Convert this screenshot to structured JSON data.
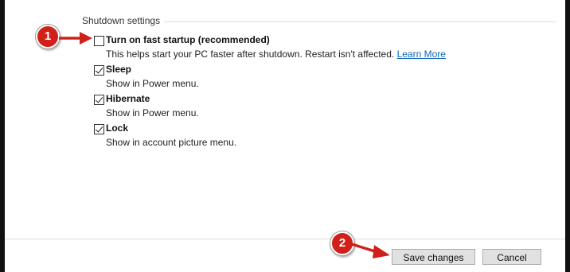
{
  "section": {
    "title": "Shutdown settings"
  },
  "options": [
    {
      "label": "Turn on fast startup (recommended)",
      "description": "This helps start your PC faster after shutdown. Restart isn't affected.",
      "link": "Learn More",
      "checked": false
    },
    {
      "label": "Sleep",
      "description": "Show in Power menu.",
      "checked": true
    },
    {
      "label": "Hibernate",
      "description": "Show in Power menu.",
      "checked": true
    },
    {
      "label": "Lock",
      "description": "Show in account picture menu.",
      "checked": true
    }
  ],
  "footer": {
    "save_label": "Save changes",
    "cancel_label": "Cancel"
  },
  "annotations": {
    "step1": "1",
    "step2": "2",
    "badge_color": "#d0201a",
    "arrow_color": "#d0201a"
  },
  "colors": {
    "link": "#0b66c3",
    "button_face": "#e1e1e1",
    "button_border": "#adadad"
  }
}
